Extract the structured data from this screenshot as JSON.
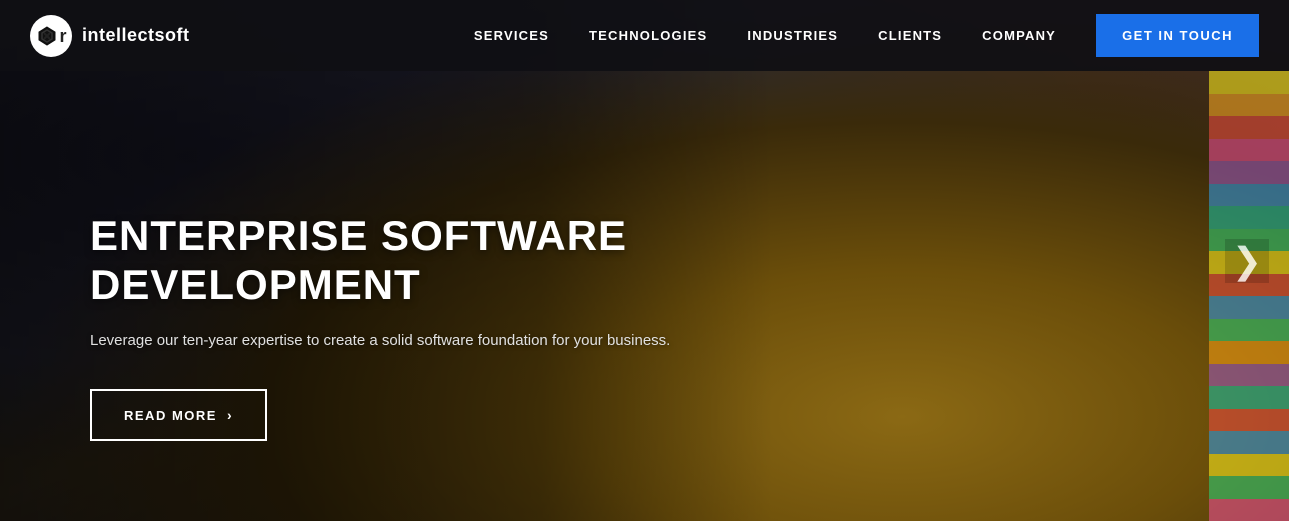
{
  "logo": {
    "brand": "intellectsoft",
    "brand_bold": "intellect",
    "brand_light": "soft"
  },
  "nav": {
    "items": [
      {
        "id": "services",
        "label": "SERVICES"
      },
      {
        "id": "technologies",
        "label": "TECHNOLOGIES"
      },
      {
        "id": "industries",
        "label": "INDUSTRIES"
      },
      {
        "id": "clients",
        "label": "CLIENTS"
      },
      {
        "id": "company",
        "label": "COMPANY"
      }
    ],
    "cta": "GET IN TOUCH"
  },
  "hero": {
    "title_line1": "ENTERPRISE SOFTWARE",
    "title_line2": "DEVELOPMENT",
    "subtitle": "Leverage our ten-year expertise to create a solid software foundation for your business.",
    "read_more": "READ MORE",
    "next_arrow": "❯"
  },
  "colors": {
    "nav_bg": "#111118",
    "cta_bg": "#1a6fe8",
    "hero_overlay": "rgba(0,0,0,0.6)",
    "accent_white": "#ffffff"
  }
}
